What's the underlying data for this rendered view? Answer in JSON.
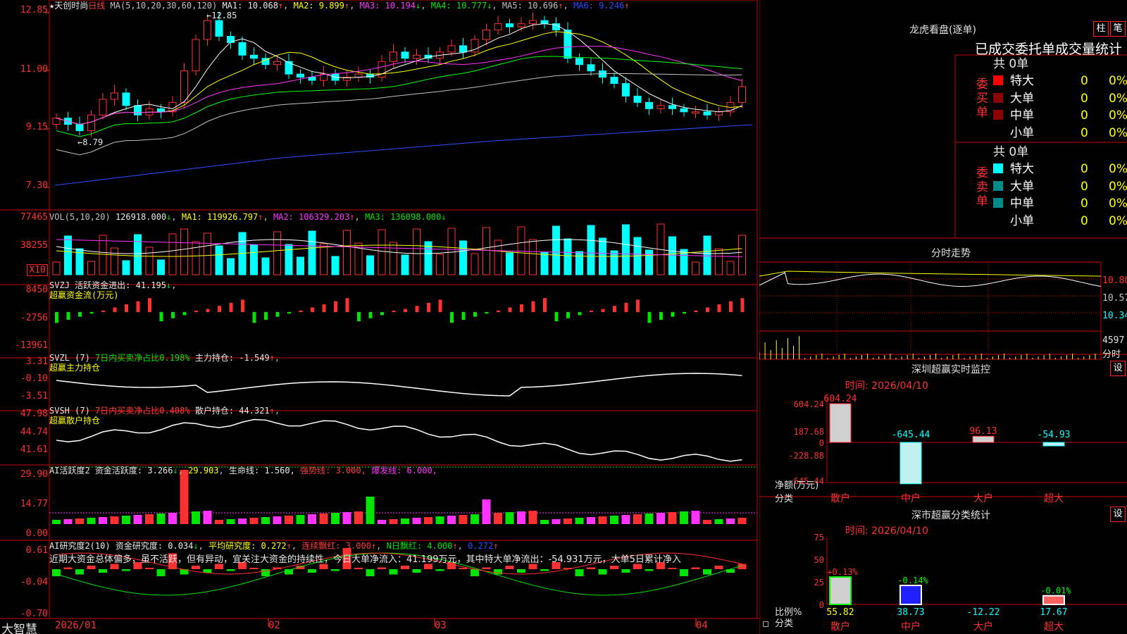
{
  "title": {
    "star": "★",
    "name": "天创时尚",
    "period": "日线",
    "ma_label": "MA(5,10,20,30,60,120)",
    "ma1": "MA1: 10.068",
    "ma2": "MA2: 9.899",
    "ma3": "MA3: 10.194",
    "ma4": "MA4: 10.777",
    "ma5": "MA5: 10.696",
    "ma6": "MA6: 9.246",
    "arrow_up": "↑",
    "arrow_down": "↓"
  },
  "price_axis": [
    "12.85",
    "11.00",
    "9.15",
    "7.30"
  ],
  "price_annotations": {
    "high": "12.85",
    "low": "8.79"
  },
  "vol": {
    "label": "VOL(5,10,20)",
    "value": "126918.000",
    "ma1": "MA1: 119926.797",
    "ma2": "MA2: 106329.203",
    "ma3": "MA3: 136098.000",
    "axis": [
      "77465",
      "38255",
      "X10"
    ]
  },
  "svzj": {
    "label": "SVZJ",
    "name": "活跃资金进出: 41.195",
    "sub": "超赢资金流(万元)",
    "axis": [
      "8450",
      "-2756",
      "-13961"
    ]
  },
  "svzl": {
    "label": "SVZL (7)",
    "ratio": "7日内买卖净占比0.198%",
    "hold": "主力持仓: -1.549",
    "sub": "超赢主力持仓",
    "axis": [
      "3.31",
      "-0.10",
      "-3.51"
    ]
  },
  "svsh": {
    "label": "SVSH (7)",
    "ratio": "7日内买卖净占比0.408%",
    "hold": "散户持仓: 44.321",
    "sub": "超赢散户持仓",
    "axis": [
      "47.98",
      "44.74",
      "41.61"
    ]
  },
  "ai_active": {
    "label": "AI活跃度2",
    "v1": "资金活跃度: 3.266",
    "v2": "29.903",
    "v3": "生命线: 1.560,",
    "v4": "强势线: 3.000,",
    "v5": "爆发线: 6.000,",
    "axis": [
      "29.90",
      "14.77",
      "0.00"
    ]
  },
  "ai_research": {
    "label": "AI研究度2(10)",
    "v1": "资金研究度: 0.034",
    "v2": "平均研究度: 0.272",
    "v3": "连续飘红: 3.000",
    "v4": "N日飘红: 4.000",
    "v5": "0.272",
    "comment": "近期大资金总体偏多，虽不活跃，但有异动，宜关注大资金的持续性，今日大单净流入：41.199万元，其中特大单净流出：-54.931万元，大单5日累计净入",
    "axis": [
      "0.61",
      "-0.04",
      "-0.70"
    ]
  },
  "bottom_bar": {
    "brand": "大智慧",
    "dates": [
      "2026/01",
      "02",
      "03",
      "04"
    ]
  },
  "right_panel": {
    "dragon_title": "龙虎看盘(逐单)",
    "btn_col": "柱",
    "btn_pen": "笔",
    "header": "已成交委托单成交量统计",
    "buy_side": "委买单",
    "sell_side": "委卖单",
    "buy_total": "共 0单",
    "sell_total": "共 0单",
    "rows": [
      {
        "label": "特大",
        "count": "0",
        "pct": "0%"
      },
      {
        "label": "大单",
        "count": "0",
        "pct": "0%"
      },
      {
        "label": "中单",
        "count": "0",
        "pct": "0%"
      },
      {
        "label": "小单",
        "count": "0",
        "pct": "0%"
      }
    ],
    "buy_colors": [
      "#ff0000",
      "#8b0000",
      "#8b0000",
      "#000000"
    ],
    "sell_colors": [
      "#00ffff",
      "#008b8b",
      "#008b8b",
      "#000000"
    ],
    "intraday_title": "分时走势",
    "intraday_axis": [
      "10.80",
      "10.57",
      "10.34"
    ],
    "intraday_vol": "4597",
    "intraday_vol_unit": "分时",
    "monitor_title": "深圳超赢实时监控",
    "monitor_btn": "设",
    "monitor_time": "时间: 2026/04/10",
    "monitor_axis": [
      "604.24",
      "187.68",
      "0",
      "-228.88",
      "-645.44"
    ],
    "monitor_ylabel": "净额(万元)",
    "monitor_xlabel": "分类",
    "monitor_cats": [
      "散户",
      "中户",
      "大户",
      "超大"
    ],
    "monitor_values": [
      604.24,
      -645.44,
      96.13,
      -54.93
    ],
    "monitor_value_labels": [
      "604.24",
      "-645.44",
      "96.13",
      "-54.93"
    ],
    "class_title": "深市超赢分类统计",
    "class_btn": "设",
    "class_time": "时间: 2026/04/10",
    "class_axis": [
      "75",
      "50",
      "25",
      "0"
    ],
    "class_ylabel": "比例%",
    "class_xlabel": "分类",
    "class_cats": [
      "散户",
      "中户",
      "大户",
      "超大"
    ],
    "class_values": [
      55.82,
      38.73,
      -12.22,
      17.67
    ],
    "class_value_labels": [
      "55.82",
      "38.73",
      "-12.22",
      "17.67"
    ],
    "class_change_labels": [
      "+0.13%",
      "-0.14%",
      "",
      "-0.01%"
    ]
  },
  "colors": {
    "up": "#ff3030",
    "down": "#00ffff",
    "grid": "#cc0000",
    "ma1": "#ffffff",
    "ma2": "#ffff00",
    "ma3": "#ff33ff",
    "ma4": "#00ff00",
    "ma5": "#c0c0c0",
    "ma6": "#2b4cff"
  }
}
